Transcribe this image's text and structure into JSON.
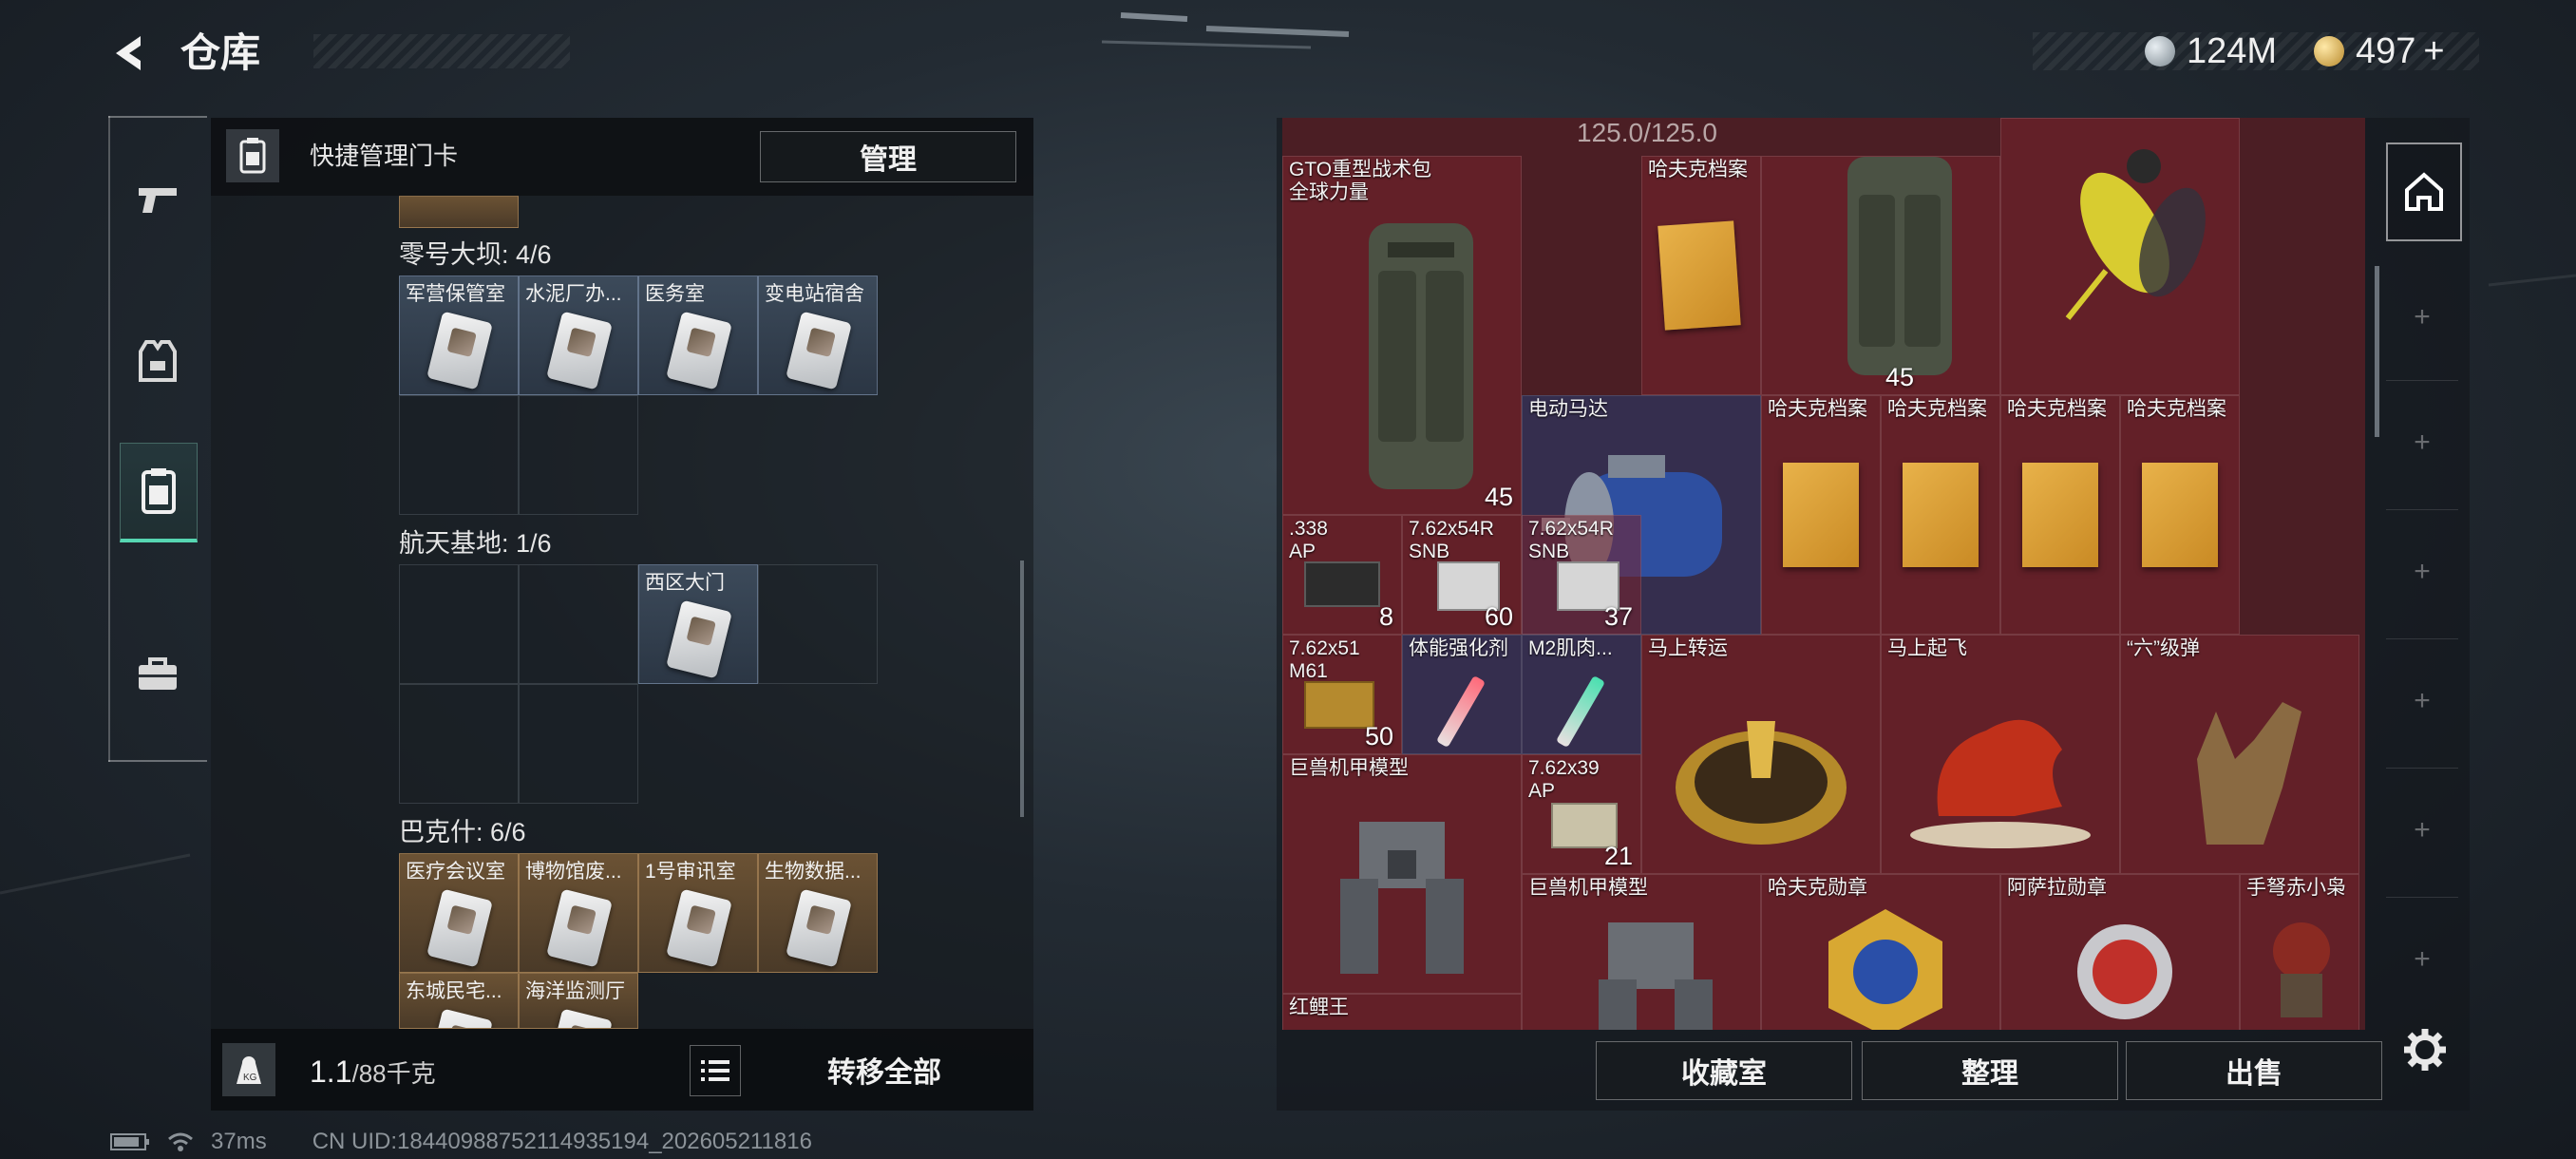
{
  "header": {
    "title": "仓库",
    "currency1": "124M",
    "currency2": "497",
    "currency2_plus": "+"
  },
  "quick_manage": {
    "label": "快捷管理门卡",
    "button": "管理"
  },
  "sections": [
    {
      "title": "零号大坝: 4/6",
      "cards": [
        "军营保管室",
        "水泥厂办...",
        "医务室",
        "变电站宿舍"
      ]
    },
    {
      "title": "航天基地: 1/6",
      "cards": [
        "西区大门"
      ]
    },
    {
      "title": "巴克什: 6/6",
      "cards": [
        "医疗会议室",
        "博物馆废...",
        "1号审讯室",
        "生物数据...",
        "东城民宅...",
        "海洋监测厅"
      ]
    }
  ],
  "bottom": {
    "weight_value": "1.1",
    "weight_unit": "/88千克",
    "transfer_all": "转移全部"
  },
  "stash": {
    "capacity": "125.0/125.0",
    "items": [
      {
        "name": "GTO重型战术包\n全球力量",
        "qty": "45"
      },
      {
        "name": "哈夫克档案",
        "qty": ""
      },
      {
        "name": "",
        "qty": "45"
      },
      {
        "name": "",
        "qty": ""
      },
      {
        "name": "电动马达",
        "qty": ""
      },
      {
        "name": "哈夫克档案",
        "qty": ""
      },
      {
        "name": "哈夫克档案",
        "qty": ""
      },
      {
        "name": "哈夫克档案",
        "qty": ""
      },
      {
        "name": "哈夫克档案",
        "qty": ""
      },
      {
        "name": ".338\nAP",
        "qty": "8"
      },
      {
        "name": "7.62x54R\nSNB",
        "qty": "60"
      },
      {
        "name": "7.62x54R\nSNB",
        "qty": "37"
      },
      {
        "name": "7.62x51\nM61",
        "qty": "50"
      },
      {
        "name": "体能强化剂",
        "qty": ""
      },
      {
        "name": "M2肌肉...",
        "qty": ""
      },
      {
        "name": "马上转运",
        "qty": ""
      },
      {
        "name": "马上起飞",
        "qty": ""
      },
      {
        "name": "“六”级弹",
        "qty": ""
      },
      {
        "name": "巨兽机甲模型",
        "qty": ""
      },
      {
        "name": "7.62x39\nAP",
        "qty": "21"
      },
      {
        "name": "巨兽机甲模型",
        "qty": ""
      },
      {
        "name": "哈夫克勋章",
        "qty": ""
      },
      {
        "name": "阿萨拉勋章",
        "qty": ""
      },
      {
        "name": "手弩赤小枭",
        "qty": ""
      },
      {
        "name": "红鲤王",
        "qty": ""
      }
    ]
  },
  "actions": {
    "collection": "收藏室",
    "organize": "整理",
    "sell": "出售"
  },
  "status": {
    "ping": "37ms",
    "uid": "CN UID:18440988752114935194_202605211816"
  },
  "colors": {
    "accent": "#56d6b2",
    "stash_bg": "#4b1e24"
  }
}
